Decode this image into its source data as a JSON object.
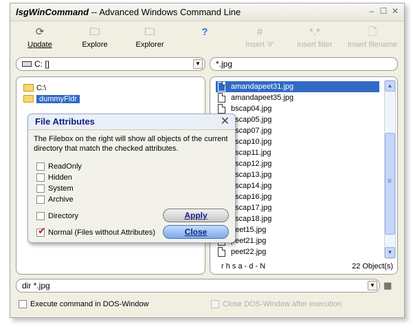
{
  "window": {
    "title_app": "lsgWinCommand",
    "title_rest": "-- Advanced Windows Command Line",
    "minimize_icon": "–",
    "maximize_icon": "☐",
    "close_icon": "✕"
  },
  "toolbar": {
    "update": {
      "label": "Update",
      "icon": "refresh-icon",
      "glyph": "⟳"
    },
    "explore": {
      "label": "Explore",
      "icon": "folder-icon",
      "glyph": "🗀"
    },
    "explorer": {
      "label": "Explorer",
      "icon": "folder-search-icon",
      "glyph": "🗀"
    },
    "help": {
      "glyph": "?",
      "icon": "help-icon"
    },
    "insert_hash": {
      "label": "Insert '#'",
      "glyph": "#",
      "icon": "hash-icon"
    },
    "insert_filter": {
      "label": "Insert filter",
      "glyph": "*.*",
      "icon": "filter-icon"
    },
    "insert_filename": {
      "label": "Insert filename",
      "glyph": "🗋",
      "icon": "file-icon"
    }
  },
  "drive_select": {
    "value": "C: []",
    "arrow": "▼"
  },
  "filter_input": {
    "value": "*.jpg"
  },
  "tree": {
    "items": [
      {
        "label": "C:\\"
      },
      {
        "label": "dummyFldr"
      }
    ]
  },
  "files": {
    "items": [
      "amandapeet31.jpg",
      "amandapeet35.jpg",
      "bscap04.jpg",
      "bscap05.jpg",
      "bscap07.jpg",
      "bscap10.jpg",
      "bscap11.jpg",
      "bscap12.jpg",
      "bscap13.jpg",
      "bscap14.jpg",
      "bscap16.jpg",
      "bscap17.jpg",
      "bscap18.jpg",
      "peet15.jpg",
      "peet21.jpg",
      "peet22.jpg"
    ],
    "status_attrs": "r h s a - d - N",
    "status_count": "22 Object(s)",
    "scroll_up": "▲",
    "scroll_down": "▼",
    "scroll_grip": "≡"
  },
  "dialog": {
    "title": "File Attributes",
    "close_glyph": "✕",
    "description": "The Filebox on the right will show all objects of the current directory that match the checked attributes.",
    "checkboxes": [
      {
        "label": "ReadOnly",
        "checked": false
      },
      {
        "label": "Hidden",
        "checked": false
      },
      {
        "label": "System",
        "checked": false
      },
      {
        "label": "Archive",
        "checked": false
      },
      {
        "label": "Directory",
        "checked": false
      },
      {
        "label": "Normal (Files without Attributes)",
        "checked": true
      }
    ],
    "check_mark": "✔",
    "apply_label": "Apply",
    "close_label": "Close"
  },
  "command": {
    "value": "dir *.jpg",
    "arrow": "▼",
    "run_glyph": "▦"
  },
  "options": {
    "dos_window": "Execute command in DOS-Window",
    "close_dos": "Close DOS-Window after execution"
  }
}
